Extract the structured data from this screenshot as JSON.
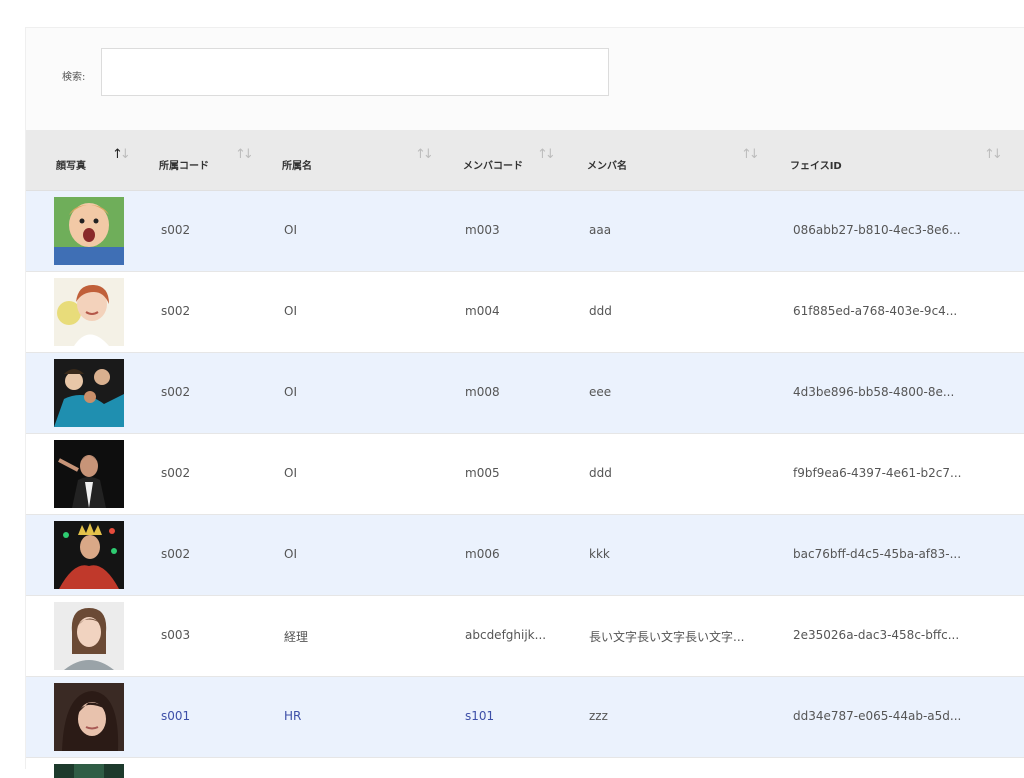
{
  "search": {
    "label": "検索:",
    "value": "",
    "placeholder": ""
  },
  "table": {
    "columns": [
      {
        "key": "photo",
        "label": "顔写真",
        "sort": "ascending"
      },
      {
        "key": "dept_code",
        "label": "所属コード",
        "sort": "none"
      },
      {
        "key": "dept_name",
        "label": "所属名",
        "sort": "none"
      },
      {
        "key": "member_code",
        "label": "メンバコード",
        "sort": "none"
      },
      {
        "key": "member_name",
        "label": "メンバ名",
        "sort": "none"
      },
      {
        "key": "face_id",
        "label": "フェイスID",
        "sort": "none"
      }
    ],
    "rows": [
      {
        "photo": "baby-portrait",
        "dept_code": "s002",
        "dept_name": "OI",
        "member_code": "m003",
        "member_name": "aaa",
        "face_id": "086abb27-b810-4ec3-8e6..."
      },
      {
        "photo": "woman-portrait",
        "dept_code": "s002",
        "dept_name": "OI",
        "member_code": "m004",
        "member_name": "ddd",
        "face_id": "61f885ed-a768-403e-9c4..."
      },
      {
        "photo": "band-photo",
        "dept_code": "s002",
        "dept_name": "OI",
        "member_code": "m008",
        "member_name": "eee",
        "face_id": "4d3be896-bb58-4800-8e..."
      },
      {
        "photo": "conductor-photo",
        "dept_code": "s002",
        "dept_name": "OI",
        "member_code": "m005",
        "member_name": "ddd",
        "face_id": "f9bf9ea6-4397-4e61-b2c7..."
      },
      {
        "photo": "king-photo",
        "dept_code": "s002",
        "dept_name": "OI",
        "member_code": "m006",
        "member_name": "kkk",
        "face_id": "bac76bff-d4c5-45ba-af83-..."
      },
      {
        "photo": "woman-portrait-2",
        "dept_code": "s003",
        "dept_name": "経理",
        "member_code": "abcdefghijk...",
        "member_name": "長い文字長い文字長い文字...",
        "face_id": "2e35026a-dac3-458c-bffc..."
      },
      {
        "photo": "woman-portrait-3",
        "dept_code": "s001",
        "dept_name": "HR",
        "member_code": "s101",
        "member_name": "zzz",
        "face_id": "dd34e787-e065-44ab-a5d..."
      }
    ]
  },
  "colors": {
    "row_stripe": "#ebf2fd",
    "header_bg": "#eaeaea",
    "highlight_text": "#3d4fa8"
  }
}
